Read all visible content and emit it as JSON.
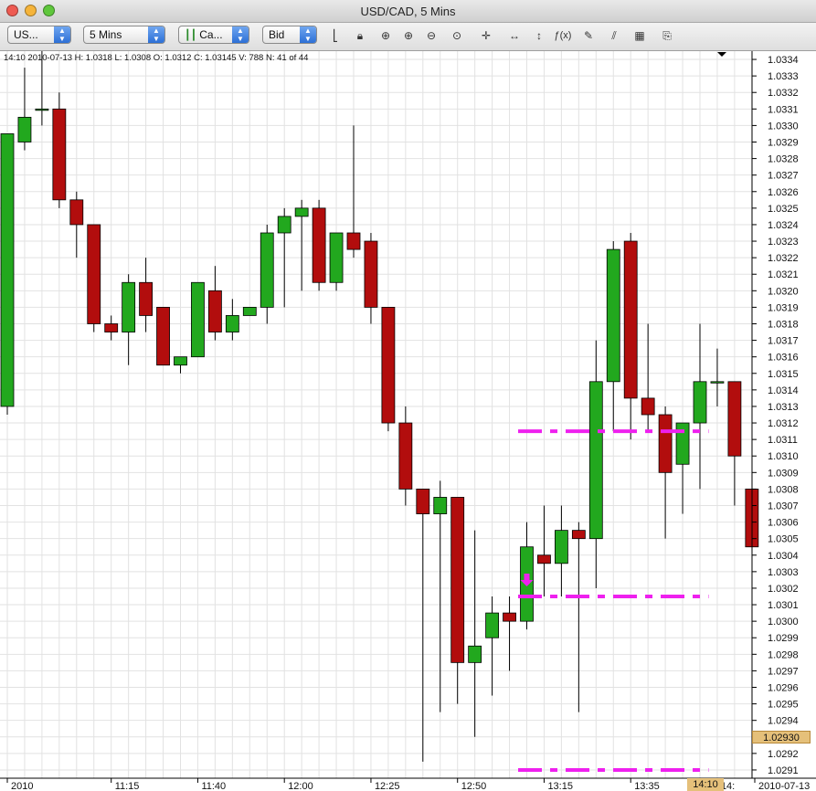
{
  "window": {
    "title": "USD/CAD,  5 Mins"
  },
  "toolbar": {
    "instrument": "US...",
    "period": "5 Mins",
    "chart_type": "Ca...",
    "side": "Bid"
  },
  "info_line": "14:10 2010-07-13 H: 1.0318 L: 1.0308 O: 1.0312 C: 1.03145 V: 788 N: 41 of 44",
  "current_price_label": "1.02930",
  "current_time_label": "14:10",
  "colors": {
    "bull": "#22a81e",
    "bear": "#b20d0d",
    "levels": "#ee20ee",
    "grid": "#e2e2e2"
  },
  "chart_data": {
    "type": "candlestick",
    "yticks": [
      "1.0291",
      "1.0292",
      "1.0293",
      "1.0294",
      "1.0295",
      "1.0296",
      "1.0297",
      "1.0298",
      "1.0299",
      "1.0300",
      "1.0301",
      "1.0302",
      "1.0303",
      "1.0304",
      "1.0305",
      "1.0306",
      "1.0307",
      "1.0308",
      "1.0309",
      "1.0310",
      "1.0311",
      "1.0312",
      "1.0313",
      "1.0314",
      "1.0315",
      "1.0316",
      "1.0317",
      "1.0318",
      "1.0319",
      "1.0320",
      "1.0321",
      "1.0322",
      "1.0323",
      "1.0324",
      "1.0325",
      "1.0326",
      "1.0327",
      "1.0328",
      "1.0329",
      "1.0330",
      "1.0331",
      "1.0332",
      "1.0333",
      "1.0334"
    ],
    "ylim": [
      1.02905,
      1.03345
    ],
    "xticks": [
      {
        "index": 0,
        "label": "2010"
      },
      {
        "index": 6,
        "label": "11:15"
      },
      {
        "index": 11,
        "label": "11:40"
      },
      {
        "index": 16,
        "label": "12:00"
      },
      {
        "index": 21,
        "label": "12:25"
      },
      {
        "index": 26,
        "label": "12:50"
      },
      {
        "index": 31,
        "label": "13:15"
      },
      {
        "index": 36,
        "label": "13:35"
      },
      {
        "index": 41,
        "label": "14:"
      },
      {
        "index": 44,
        "label": "2010-07-13"
      }
    ],
    "candles": [
      {
        "o": 1.0313,
        "h": 1.03295,
        "l": 1.03125,
        "c": 1.03295
      },
      {
        "o": 1.0329,
        "h": 1.03335,
        "l": 1.03285,
        "c": 1.03305
      },
      {
        "o": 1.0331,
        "h": 1.03345,
        "l": 1.033,
        "c": 1.0331
      },
      {
        "o": 1.0331,
        "h": 1.0332,
        "l": 1.0325,
        "c": 1.03255
      },
      {
        "o": 1.03255,
        "h": 1.0326,
        "l": 1.0322,
        "c": 1.0324
      },
      {
        "o": 1.0324,
        "h": 1.0324,
        "l": 1.03175,
        "c": 1.0318
      },
      {
        "o": 1.0318,
        "h": 1.03185,
        "l": 1.0317,
        "c": 1.03175
      },
      {
        "o": 1.03175,
        "h": 1.0321,
        "l": 1.03155,
        "c": 1.03205
      },
      {
        "o": 1.03205,
        "h": 1.0322,
        "l": 1.03175,
        "c": 1.03185
      },
      {
        "o": 1.0319,
        "h": 1.0319,
        "l": 1.03155,
        "c": 1.03155
      },
      {
        "o": 1.03155,
        "h": 1.0316,
        "l": 1.0315,
        "c": 1.0316
      },
      {
        "o": 1.0316,
        "h": 1.03205,
        "l": 1.0316,
        "c": 1.03205
      },
      {
        "o": 1.032,
        "h": 1.03215,
        "l": 1.0317,
        "c": 1.03175
      },
      {
        "o": 1.03175,
        "h": 1.03195,
        "l": 1.0317,
        "c": 1.03185
      },
      {
        "o": 1.03185,
        "h": 1.0319,
        "l": 1.03185,
        "c": 1.0319
      },
      {
        "o": 1.0319,
        "h": 1.0324,
        "l": 1.0318,
        "c": 1.03235
      },
      {
        "o": 1.03235,
        "h": 1.0325,
        "l": 1.0319,
        "c": 1.03245
      },
      {
        "o": 1.03245,
        "h": 1.03255,
        "l": 1.032,
        "c": 1.0325
      },
      {
        "o": 1.0325,
        "h": 1.03255,
        "l": 1.032,
        "c": 1.03205
      },
      {
        "o": 1.03205,
        "h": 1.03235,
        "l": 1.032,
        "c": 1.03235
      },
      {
        "o": 1.03235,
        "h": 1.033,
        "l": 1.0322,
        "c": 1.03225
      },
      {
        "o": 1.0323,
        "h": 1.03235,
        "l": 1.0318,
        "c": 1.0319
      },
      {
        "o": 1.0319,
        "h": 1.0319,
        "l": 1.03115,
        "c": 1.0312
      },
      {
        "o": 1.0312,
        "h": 1.0313,
        "l": 1.0307,
        "c": 1.0308
      },
      {
        "o": 1.0308,
        "h": 1.0308,
        "l": 1.02915,
        "c": 1.03065
      },
      {
        "o": 1.03065,
        "h": 1.03085,
        "l": 1.02945,
        "c": 1.03075
      },
      {
        "o": 1.03075,
        "h": 1.03075,
        "l": 1.0295,
        "c": 1.02975
      },
      {
        "o": 1.02975,
        "h": 1.03055,
        "l": 1.0293,
        "c": 1.02985
      },
      {
        "o": 1.0299,
        "h": 1.03015,
        "l": 1.02955,
        "c": 1.03005
      },
      {
        "o": 1.03005,
        "h": 1.03015,
        "l": 1.0297,
        "c": 1.03
      },
      {
        "o": 1.03,
        "h": 1.0306,
        "l": 1.02995,
        "c": 1.03045
      },
      {
        "o": 1.0304,
        "h": 1.0307,
        "l": 1.03015,
        "c": 1.03035
      },
      {
        "o": 1.03035,
        "h": 1.0307,
        "l": 1.03015,
        "c": 1.03055
      },
      {
        "o": 1.03055,
        "h": 1.0306,
        "l": 1.02945,
        "c": 1.0305
      },
      {
        "o": 1.0305,
        "h": 1.0317,
        "l": 1.0302,
        "c": 1.03145
      },
      {
        "o": 1.03145,
        "h": 1.0323,
        "l": 1.03115,
        "c": 1.03225
      },
      {
        "o": 1.0323,
        "h": 1.03235,
        "l": 1.0311,
        "c": 1.03135
      },
      {
        "o": 1.03135,
        "h": 1.0318,
        "l": 1.03115,
        "c": 1.03125
      },
      {
        "o": 1.03125,
        "h": 1.0313,
        "l": 1.0305,
        "c": 1.0309
      },
      {
        "o": 1.03095,
        "h": 1.03115,
        "l": 1.03065,
        "c": 1.0312
      },
      {
        "o": 1.0312,
        "h": 1.0318,
        "l": 1.0308,
        "c": 1.03145
      },
      {
        "o": 1.03145,
        "h": 1.03165,
        "l": 1.0313,
        "c": 1.03145
      },
      {
        "o": 1.03145,
        "h": 1.03145,
        "l": 1.0307,
        "c": 1.031
      },
      {
        "o": 1.0308,
        "h": 1.0308,
        "l": 1.03045,
        "c": 1.03045
      }
    ],
    "lines": [
      {
        "y": 1.03115,
        "from": 29.5,
        "to": 40.5
      },
      {
        "y": 1.03015,
        "from": 29.5,
        "to": 40.5
      },
      {
        "y": 1.0291,
        "from": 29.5,
        "to": 40.5
      }
    ],
    "arrow": {
      "index": 30,
      "y": 1.0302
    }
  }
}
